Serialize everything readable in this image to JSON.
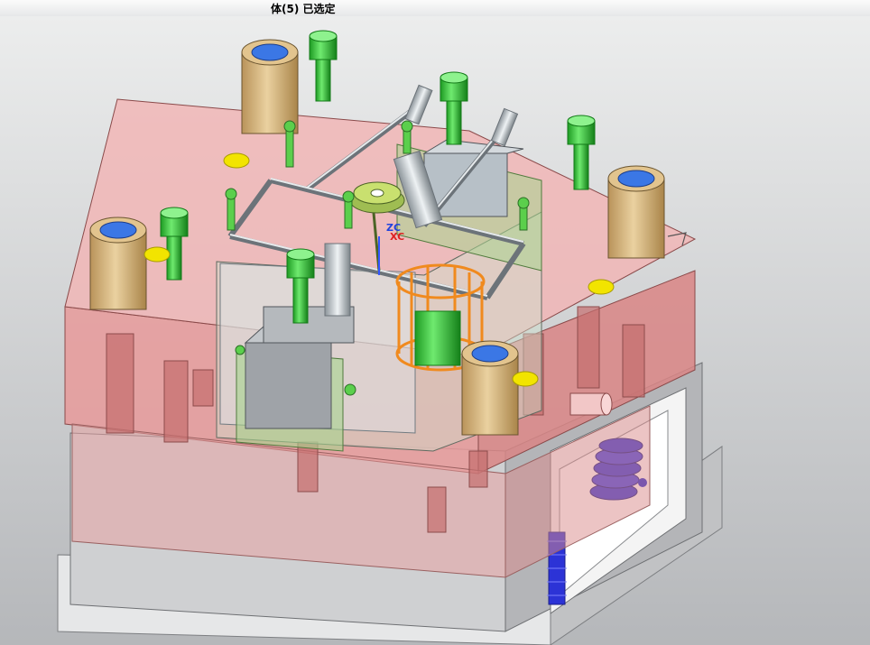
{
  "status_bar": {
    "selection_text": "体(5) 已选定"
  },
  "viewport": {
    "background_top": "#e8e9ea",
    "background_bottom": "#b7b9bc",
    "colors": {
      "cavity_plate": "#e9a6a6",
      "core_plate": "#c8c8c8",
      "guide_bushing": "#d6b27a",
      "screw": "#35c53a",
      "marker": "#f2e400",
      "selected": "#f08a1e",
      "spring": "#2c33d6",
      "slider": "#b7d9a0"
    }
  }
}
